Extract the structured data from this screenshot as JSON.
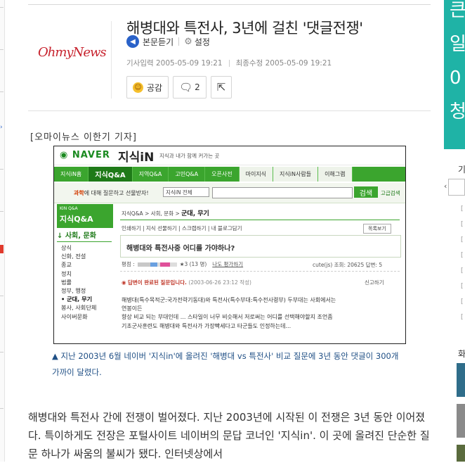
{
  "article": {
    "title": "해병대와 특전사, 3년에 걸친 '댓글전쟁'",
    "logo": "OhmyNews",
    "listen_label": "본문듣기",
    "settings_label": "설정",
    "published": "기사입력 2005-05-09 19:21",
    "modified": "최종수정 2005-05-09 19:21",
    "like_label": "공감",
    "comment_count": "2",
    "reporter": "[오마이뉴스 이한기 기자]",
    "caption": "▲ 지난 2003년 6월 네이버 '지식in'에 올려진 '해병대 vs 특전사' 비교 질문에 3년 동안 댓글이 300개 가까이 달렸다.",
    "body": "해병대와 특전사 간에 전쟁이 벌어졌다. 지난 2003년에 시작된 이 전쟁은 3년 동안 이어졌다. 특이하게도 전장은 포털사이트 네이버의 문답 코너인 '지식in'. 이 곳에 올려진 단순한 질문 하나가 싸움의 불씨가 됐다. 인터넷상에서"
  },
  "screenshot": {
    "naver_logo": "NAVER",
    "jisik": "지식iN",
    "tagline": "지식과 내가 함께 커가는 곳",
    "tabs": [
      "지식iN홈",
      "지식Q&A",
      "지역Q&A",
      "고민Q&A",
      "오픈사전",
      "마이지식",
      "지식iN사람들",
      "이해그램"
    ],
    "search_prompt_b": "과학",
    "search_prompt": "에 대해 질문하고 선물받자!",
    "search_select": "지식iN 전체",
    "search_btn": "검색",
    "advanced": "고급검색",
    "side_small": "KIN Q&A",
    "side_title": "지식Q&A",
    "side_cat": "↓ 사회, 문화",
    "side_items": [
      "상식",
      "신화, 전설",
      "종교",
      "정치",
      "법률",
      "정부, 행정",
      "• 군대, 무기",
      "봉사, 사회단체",
      "사이버문화"
    ],
    "crumb": "지식Q&A > 사회, 문화 > ",
    "crumb_cur": "군대, 무기",
    "tools": "인쇄하기 | 지식 선물하기 | 스크랩하기 | 내 블로그담기",
    "list_btn": "목록보기",
    "question": "해병대와 특전사중 어디를 가야하나?",
    "rating_label": "평점 :",
    "rating_count": "3 (13 명)",
    "rate_link": "나도 평가하기",
    "user_info": "cute(js)   조회: 20625   답변: 5",
    "answer_done": "답변이 완료된 질문입니다.",
    "answer_date": "(2003-06-26 23:12 작성)",
    "report": "신고하기",
    "body_lines": [
      "해병대(특수목적군:국가전략기동대)와 특전사(특수부대:특수전사령부) 두부대는 사회에서는",
      "연봉이든",
      "향상 비교 되는 부대인데 ... 스타일이 너무 비슷해서 저로써는 어디를 선택해야할지 조언좀",
      "기초군사훈련도 해병대와 특전사가 가장빡세다고 타군들도 인정하는데..."
    ]
  },
  "right_rail": {
    "banner_chars": [
      "큰",
      "일",
      "0",
      "청"
    ],
    "label1": "기",
    "label2": "화",
    "marks": [
      "[",
      "[",
      "[",
      "[",
      "[",
      "[",
      "[",
      "["
    ]
  },
  "colors": {
    "naver_green": "#3ba52e",
    "caption_blue": "#1f4f85",
    "teal": "#1fb3a6",
    "logo_red": "#c7232e"
  }
}
